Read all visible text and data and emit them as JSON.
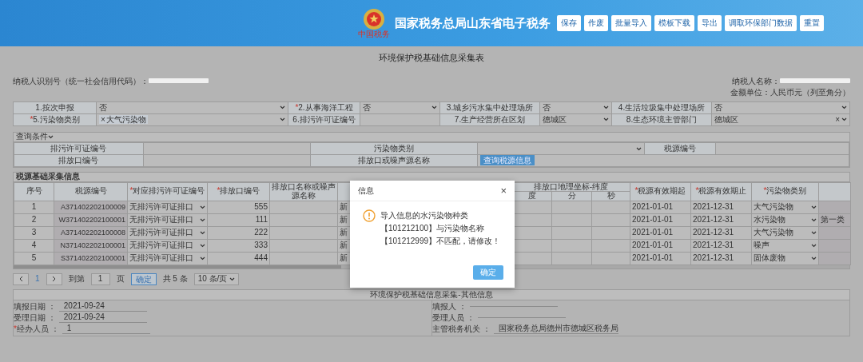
{
  "header": {
    "title": "国家税务总局山东省电子税务",
    "logo_caption": "中国税务",
    "buttons": [
      "保存",
      "作废",
      "批量导入",
      "模板下载",
      "导出",
      "调取环保部门数据",
      "重置"
    ]
  },
  "form": {
    "title": "环境保护税基础信息采集表",
    "taxpayer_id_label": "纳税人识别号（统一社会信用代码）：",
    "taxpayer_name_label": "纳税人名称：",
    "unit_note": "金额单位：人民币元（列至角分）"
  },
  "basic_info": [
    {
      "label": "1.按次申报",
      "kind": "select",
      "value": "否"
    },
    {
      "label": "2.从事海洋工程",
      "required_mark": "*",
      "kind": "select",
      "value": "否"
    },
    {
      "label": "3.城乡污水集中处理场所",
      "kind": "select",
      "value": "否"
    },
    {
      "label": "4.生活垃圾集中处理场所",
      "kind": "select",
      "value": "否"
    },
    {
      "label": "5.污染物类别",
      "required_mark": "*",
      "kind": "tag",
      "value": "大气污染物",
      "remove": "×"
    },
    {
      "label": "6.排污许可证编号",
      "kind": "input"
    },
    {
      "label": "7.生产经营所在区划",
      "kind": "select",
      "value": "德城区"
    },
    {
      "label": "8.生态环境主管部门",
      "kind": "clearable",
      "value": "德城区",
      "clear": "×"
    }
  ],
  "query": {
    "title": "查询条件",
    "fields": [
      {
        "label": "排污许可证编号",
        "kind": "input"
      },
      {
        "label": "污染物类别",
        "kind": "select"
      },
      {
        "label": "税源编号",
        "kind": "input"
      },
      {
        "label": "排放口编号",
        "kind": "input"
      },
      {
        "label": "排放口或噪声源名称"
      }
    ],
    "button": "查询税源信息"
  },
  "sources": {
    "title": "税源基础采集信息",
    "columns": [
      {
        "label": "序号"
      },
      {
        "label": "税源编号"
      },
      {
        "label": "对应排污许可证编号",
        "required_mark": "*"
      },
      {
        "label": "排放口编号",
        "required_mark": "*"
      },
      {
        "label": "排放口名称或噪声源名称"
      }
    ],
    "coordinate_group": {
      "label": "排放口地理坐标-纬度",
      "sub": [
        "度",
        "分",
        "秒"
      ]
    },
    "end_columns": [
      {
        "label": "税源有效期起",
        "required_mark": "*"
      },
      {
        "label": "税源有效期止",
        "required_mark": "*"
      },
      {
        "label": "污染物类别",
        "required_mark": "*"
      }
    ],
    "rows": [
      {
        "no": "1",
        "source_id": "A371402202100009",
        "permit": "无排污许可证排口",
        "outlet": "555",
        "column_6": "新",
        "start": "2021-01-01",
        "end": "2021-12-31",
        "category": "大气污染物"
      },
      {
        "no": "2",
        "source_id": "W371402202100001",
        "permit": "无排污许可证排口",
        "outlet": "111",
        "column_6": "新",
        "start": "2021-01-01",
        "end": "2021-12-31",
        "category": "水污染物",
        "column_last": "第一类"
      },
      {
        "no": "3",
        "source_id": "A371402202100008",
        "permit": "无排污许可证排口",
        "outlet": "222",
        "column_6": "新",
        "start": "2021-01-01",
        "end": "2021-12-31",
        "category": "大气污染物"
      },
      {
        "no": "4",
        "source_id": "N371402202100001",
        "permit": "无排污许可证排口",
        "outlet": "333",
        "column_6": "新",
        "start": "2021-01-01",
        "end": "2021-12-31",
        "category": "噪声"
      },
      {
        "no": "5",
        "source_id": "S371402202100001",
        "permit": "无排污许可证排口",
        "outlet": "444",
        "column_6": "新",
        "start": "2021-01-01",
        "end": "2021-12-31",
        "category": "固体废物"
      }
    ]
  },
  "pagination": {
    "current": "1",
    "goto_label": "到第",
    "page_input": "1",
    "page_unit": "页",
    "confirm": "确定",
    "total": "共 5 条",
    "page_size": "10 条/页"
  },
  "other_info": {
    "title": "环境保护税基础信息采集-其他信息",
    "left": [
      {
        "label": "填报日期 ：",
        "value": "2021-09-24"
      },
      {
        "label": "受理日期 ：",
        "value": "2021-09-24"
      },
      {
        "label": "经办人员 ：",
        "value": "1",
        "required_mark": "*"
      }
    ],
    "right": [
      {
        "label": "填报人 ："
      },
      {
        "label": "受理人员 ："
      },
      {
        "label": "主管税务机关 ：",
        "value": "国家税务总局德州市德城区税务局"
      }
    ]
  },
  "dialog": {
    "title": "信息",
    "close": "×",
    "message": "导入信息的水污染物种类【101212100】与污染物名称【101212999】不匹配，请修改！",
    "button": "确定"
  }
}
